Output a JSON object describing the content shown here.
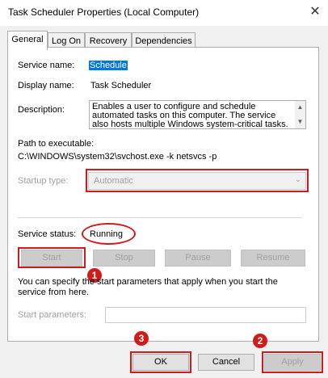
{
  "window": {
    "title": "Task Scheduler Properties (Local Computer)",
    "close_glyph": "✕"
  },
  "tabs": [
    {
      "label": "General",
      "active": true
    },
    {
      "label": "Log On"
    },
    {
      "label": "Recovery"
    },
    {
      "label": "Dependencies"
    }
  ],
  "general": {
    "service_name_label": "Service name:",
    "service_name_value": "Schedule",
    "display_name_label": "Display name:",
    "display_name_value": "Task Scheduler",
    "description_label": "Description:",
    "description_value": "Enables a user to configure and schedule automated tasks on this computer. The service also hosts multiple Windows system-critical tasks. If this",
    "path_label": "Path to executable:",
    "path_value": "C:\\WINDOWS\\system32\\svchost.exe -k netsvcs -p",
    "startup_type_label": "Startup type:",
    "startup_type_value": "Automatic",
    "service_status_label": "Service status:",
    "service_status_value": "Running",
    "buttons": {
      "start": "Start",
      "stop": "Stop",
      "pause": "Pause",
      "resume": "Resume"
    },
    "params_hint": "You can specify the start parameters that apply when you start the service from here.",
    "start_params_label": "Start parameters:",
    "start_params_value": ""
  },
  "footer": {
    "ok": "OK",
    "cancel": "Cancel",
    "apply": "Apply"
  },
  "annotations": {
    "badge_1": "1",
    "badge_2": "2",
    "badge_3": "3",
    "color": "#d11b1b"
  }
}
